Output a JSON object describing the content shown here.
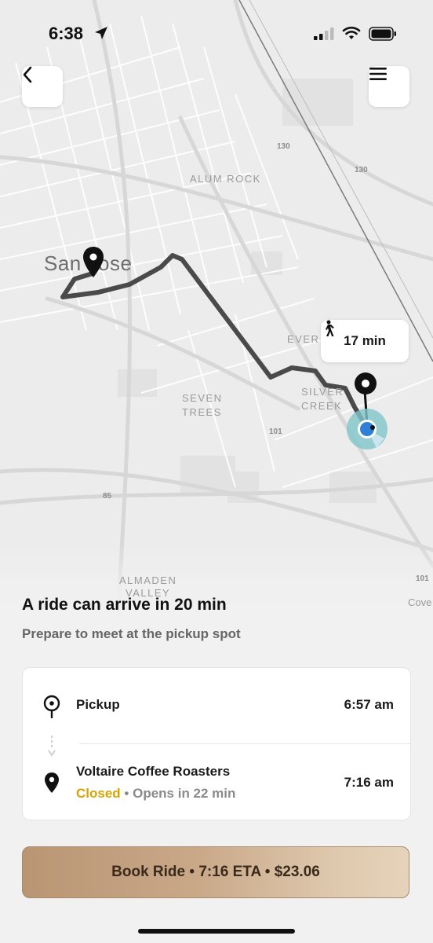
{
  "status_bar": {
    "time": "6:38",
    "location_icon": "location-arrow-icon",
    "icons": [
      "cellular-signal-icon",
      "wifi-icon",
      "battery-icon"
    ]
  },
  "map": {
    "labels": {
      "city": "San Jose",
      "alum_rock": "ALUM ROCK",
      "seven_trees_1": "SEVEN",
      "seven_trees_2": "TREES",
      "silver_1": "SILVER",
      "silver_2": "CREEK",
      "evergreen": "EVER",
      "almaden_1": "ALMADEN",
      "almaden_2": "VALLEY",
      "coyote": "Cove"
    },
    "road_numbers": {
      "r130a": "130",
      "r130b": "130",
      "r101a": "101",
      "r101b": "101",
      "r85": "85"
    },
    "walk_time": "17 min",
    "colors": {
      "route": "#4a4a4a",
      "user_location": "#2f80d8",
      "user_halo": "#7fc6c9"
    }
  },
  "nav": {
    "back_icon": "chevron-left-icon",
    "menu_icon": "hamburger-menu-icon"
  },
  "ride": {
    "headline": "A ride can arrive in 20 min",
    "subhead": "Prepare to meet at the pickup spot"
  },
  "trip": {
    "pickup": {
      "label": "Pickup",
      "time": "6:57 am",
      "icon": "pickup-pin-icon"
    },
    "dropoff": {
      "label": "Voltaire Coffee Roasters",
      "time": "7:16 am",
      "status": "Closed",
      "separator": " • ",
      "opens": "Opens in 22 min",
      "icon": "dropoff-pin-icon"
    }
  },
  "book_button": {
    "label": "Book Ride • 7:16 ETA • $23.06",
    "colors": {
      "gold_start": "#b99573",
      "gold_end": "#e6d3bb"
    }
  }
}
